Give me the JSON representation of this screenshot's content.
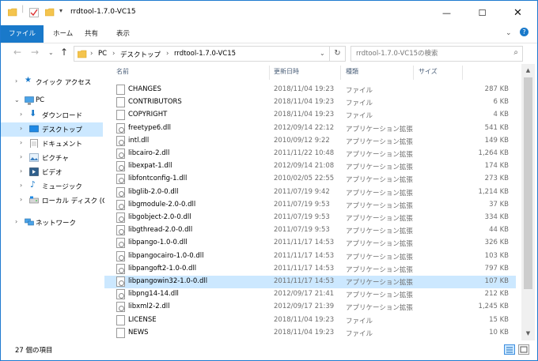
{
  "window": {
    "title": "rrdtool-1.7.0-VC15"
  },
  "ribbon": {
    "tabs": [
      "ファイル",
      "ホーム",
      "共有",
      "表示"
    ]
  },
  "address": {
    "crumbs": [
      "PC",
      "デスクトップ",
      "rrdtool-1.7.0-VC15"
    ]
  },
  "search": {
    "placeholder": "rrdtool-1.7.0-VC15の検索"
  },
  "nav": {
    "items": [
      {
        "label": "クイック アクセス",
        "icon": "star-icon"
      },
      {
        "label": "PC",
        "icon": "pc-icon"
      },
      {
        "label": "ダウンロード",
        "icon": "download-icon"
      },
      {
        "label": "デスクトップ",
        "icon": "desktop-icon"
      },
      {
        "label": "ドキュメント",
        "icon": "document-icon"
      },
      {
        "label": "ピクチャ",
        "icon": "pictures-icon"
      },
      {
        "label": "ビデオ",
        "icon": "video-icon"
      },
      {
        "label": "ミュージック",
        "icon": "music-icon"
      },
      {
        "label": "ローカル ディスク (C:)",
        "icon": "disk-icon"
      },
      {
        "label": "ネットワーク",
        "icon": "network-icon"
      }
    ]
  },
  "columns": {
    "name": "名前",
    "date": "更新日時",
    "type": "種類",
    "size": "サイズ"
  },
  "files": [
    {
      "name": "CHANGES",
      "date": "2018/11/04 19:23",
      "type": "ファイル",
      "size": "287 KB",
      "kind": "file"
    },
    {
      "name": "CONTRIBUTORS",
      "date": "2018/11/04 19:23",
      "type": "ファイル",
      "size": "6 KB",
      "kind": "file"
    },
    {
      "name": "COPYRIGHT",
      "date": "2018/11/04 19:23",
      "type": "ファイル",
      "size": "4 KB",
      "kind": "file"
    },
    {
      "name": "freetype6.dll",
      "date": "2012/09/14 22:12",
      "type": "アプリケーション拡張",
      "size": "541 KB",
      "kind": "dll"
    },
    {
      "name": "intl.dll",
      "date": "2010/09/12 9:22",
      "type": "アプリケーション拡張",
      "size": "149 KB",
      "kind": "dll"
    },
    {
      "name": "libcairo-2.dll",
      "date": "2011/11/22 10:48",
      "type": "アプリケーション拡張",
      "size": "1,264 KB",
      "kind": "dll"
    },
    {
      "name": "libexpat-1.dll",
      "date": "2012/09/14 21:08",
      "type": "アプリケーション拡張",
      "size": "174 KB",
      "kind": "dll"
    },
    {
      "name": "libfontconfig-1.dll",
      "date": "2010/02/05 22:55",
      "type": "アプリケーション拡張",
      "size": "273 KB",
      "kind": "dll"
    },
    {
      "name": "libglib-2.0-0.dll",
      "date": "2011/07/19 9:42",
      "type": "アプリケーション拡張",
      "size": "1,214 KB",
      "kind": "dll"
    },
    {
      "name": "libgmodule-2.0-0.dll",
      "date": "2011/07/19 9:53",
      "type": "アプリケーション拡張",
      "size": "37 KB",
      "kind": "dll"
    },
    {
      "name": "libgobject-2.0-0.dll",
      "date": "2011/07/19 9:53",
      "type": "アプリケーション拡張",
      "size": "334 KB",
      "kind": "dll"
    },
    {
      "name": "libgthread-2.0-0.dll",
      "date": "2011/07/19 9:53",
      "type": "アプリケーション拡張",
      "size": "44 KB",
      "kind": "dll"
    },
    {
      "name": "libpango-1.0-0.dll",
      "date": "2011/11/17 14:53",
      "type": "アプリケーション拡張",
      "size": "326 KB",
      "kind": "dll"
    },
    {
      "name": "libpangocairo-1.0-0.dll",
      "date": "2011/11/17 14:53",
      "type": "アプリケーション拡張",
      "size": "103 KB",
      "kind": "dll"
    },
    {
      "name": "libpangoft2-1.0-0.dll",
      "date": "2011/11/17 14:53",
      "type": "アプリケーション拡張",
      "size": "797 KB",
      "kind": "dll"
    },
    {
      "name": "libpangowin32-1.0-0.dll",
      "date": "2011/11/17 14:53",
      "type": "アプリケーション拡張",
      "size": "107 KB",
      "kind": "dll",
      "selected": true
    },
    {
      "name": "libpng14-14.dll",
      "date": "2012/09/17 21:41",
      "type": "アプリケーション拡張",
      "size": "212 KB",
      "kind": "dll"
    },
    {
      "name": "libxml2-2.dll",
      "date": "2012/09/17 21:39",
      "type": "アプリケーション拡張",
      "size": "1,245 KB",
      "kind": "dll"
    },
    {
      "name": "LICENSE",
      "date": "2018/11/04 19:23",
      "type": "ファイル",
      "size": "15 KB",
      "kind": "file"
    },
    {
      "name": "NEWS",
      "date": "2018/11/04 19:23",
      "type": "ファイル",
      "size": "10 KB",
      "kind": "file"
    }
  ],
  "status": {
    "count": "27 個の項目"
  },
  "colors": {
    "accent": "#1979ca",
    "selection": "#cce8ff"
  }
}
